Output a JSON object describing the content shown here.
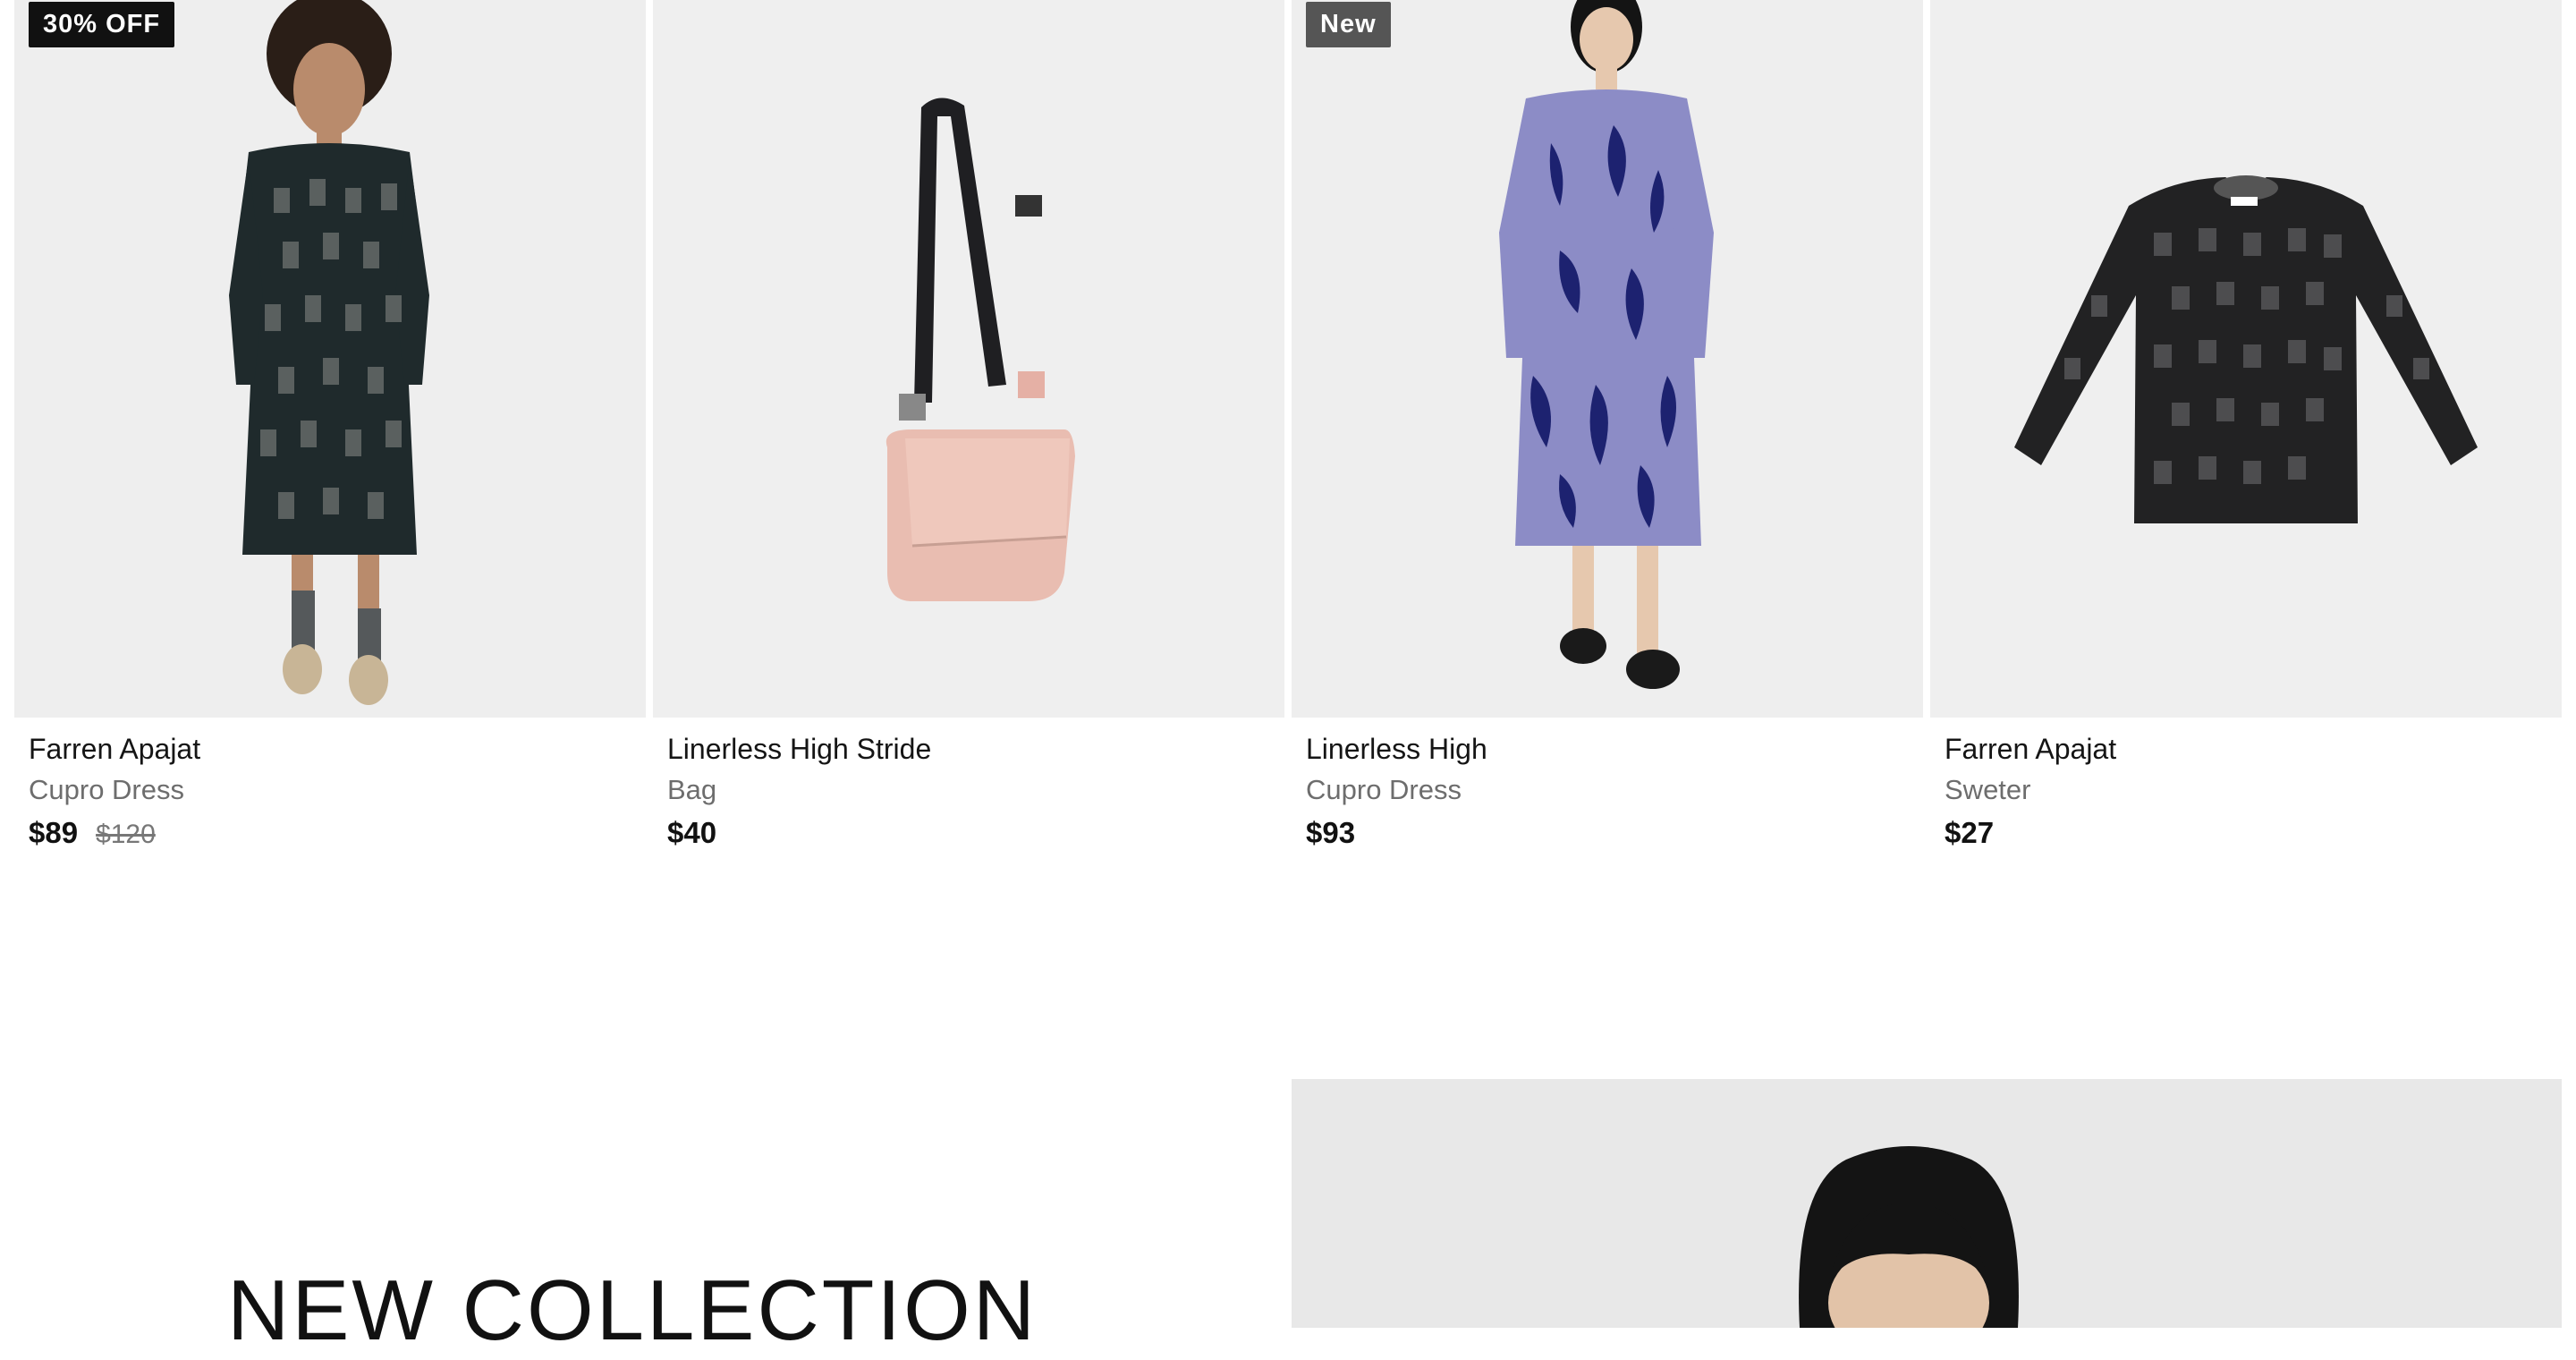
{
  "products": [
    {
      "name": "Farren Apajat",
      "sub": "Cupro Dress",
      "price": "$89",
      "old_price": "$120",
      "badge": "30% OFF",
      "icon": "dress-model-image"
    },
    {
      "name": "Linerless High Stride",
      "sub": "Bag",
      "price": "$40",
      "old_price": "",
      "badge": "",
      "icon": "bag-image"
    },
    {
      "name": "Linerless High",
      "sub": "Cupro Dress",
      "price": "$93",
      "old_price": "",
      "badge": "New",
      "icon": "dress-model-image"
    },
    {
      "name": "Farren Apajat",
      "sub": "Sweter",
      "price": "$27",
      "old_price": "",
      "badge": "",
      "icon": "sweater-image"
    }
  ],
  "promo": {
    "title": "NEW COLLECTION"
  },
  "colors": {
    "sale_badge": "#111111",
    "new_badge": "#555555",
    "muted_text": "#6d6d6d",
    "image_bg": "#efefef"
  }
}
